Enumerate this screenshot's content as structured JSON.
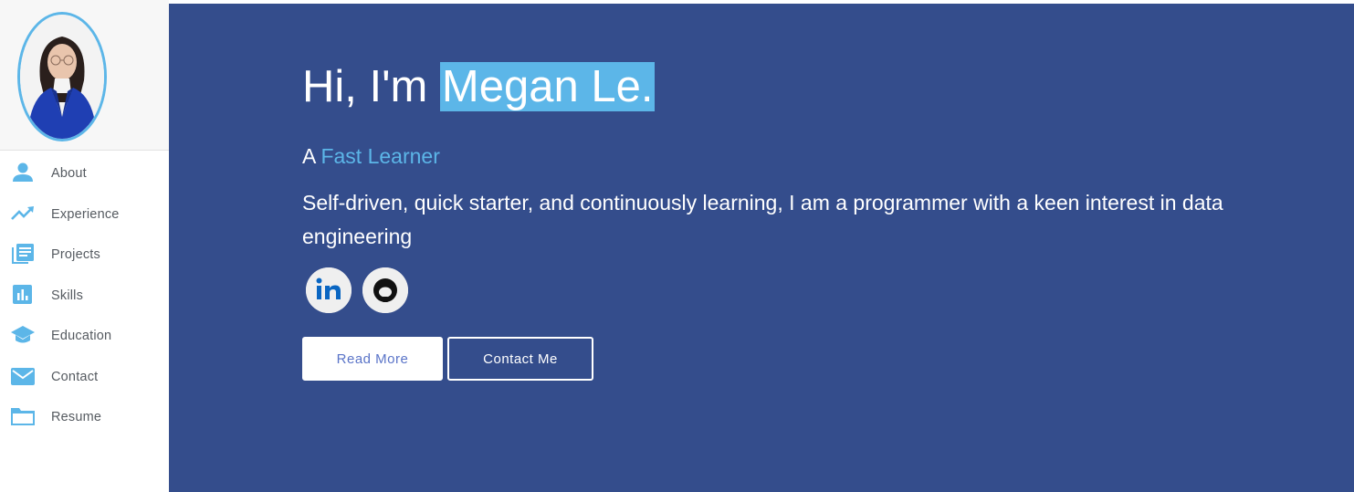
{
  "sidebar": {
    "items": [
      {
        "label": "About",
        "icon": "person-icon"
      },
      {
        "label": "Experience",
        "icon": "trending-up-icon"
      },
      {
        "label": "Projects",
        "icon": "library-books-icon"
      },
      {
        "label": "Skills",
        "icon": "bar-chart-icon"
      },
      {
        "label": "Education",
        "icon": "graduation-cap-icon"
      },
      {
        "label": "Contact",
        "icon": "mail-icon"
      },
      {
        "label": "Resume",
        "icon": "folder-icon"
      }
    ]
  },
  "hero": {
    "greeting": "Hi, I'm ",
    "name": "Megan Le.",
    "tagline_prefix": "A ",
    "tagline_role": "Fast Learner",
    "description": "Self-driven, quick starter, and continuously learning, I am a programmer with a keen interest in data engineering",
    "social": [
      {
        "icon": "linkedin-icon"
      },
      {
        "icon": "github-icon"
      }
    ],
    "read_more_label": "Read More",
    "contact_label": "Contact Me"
  },
  "colors": {
    "accent": "#5cb6e8",
    "hero_background": "#344d8c",
    "nav_text": "#555a60"
  }
}
